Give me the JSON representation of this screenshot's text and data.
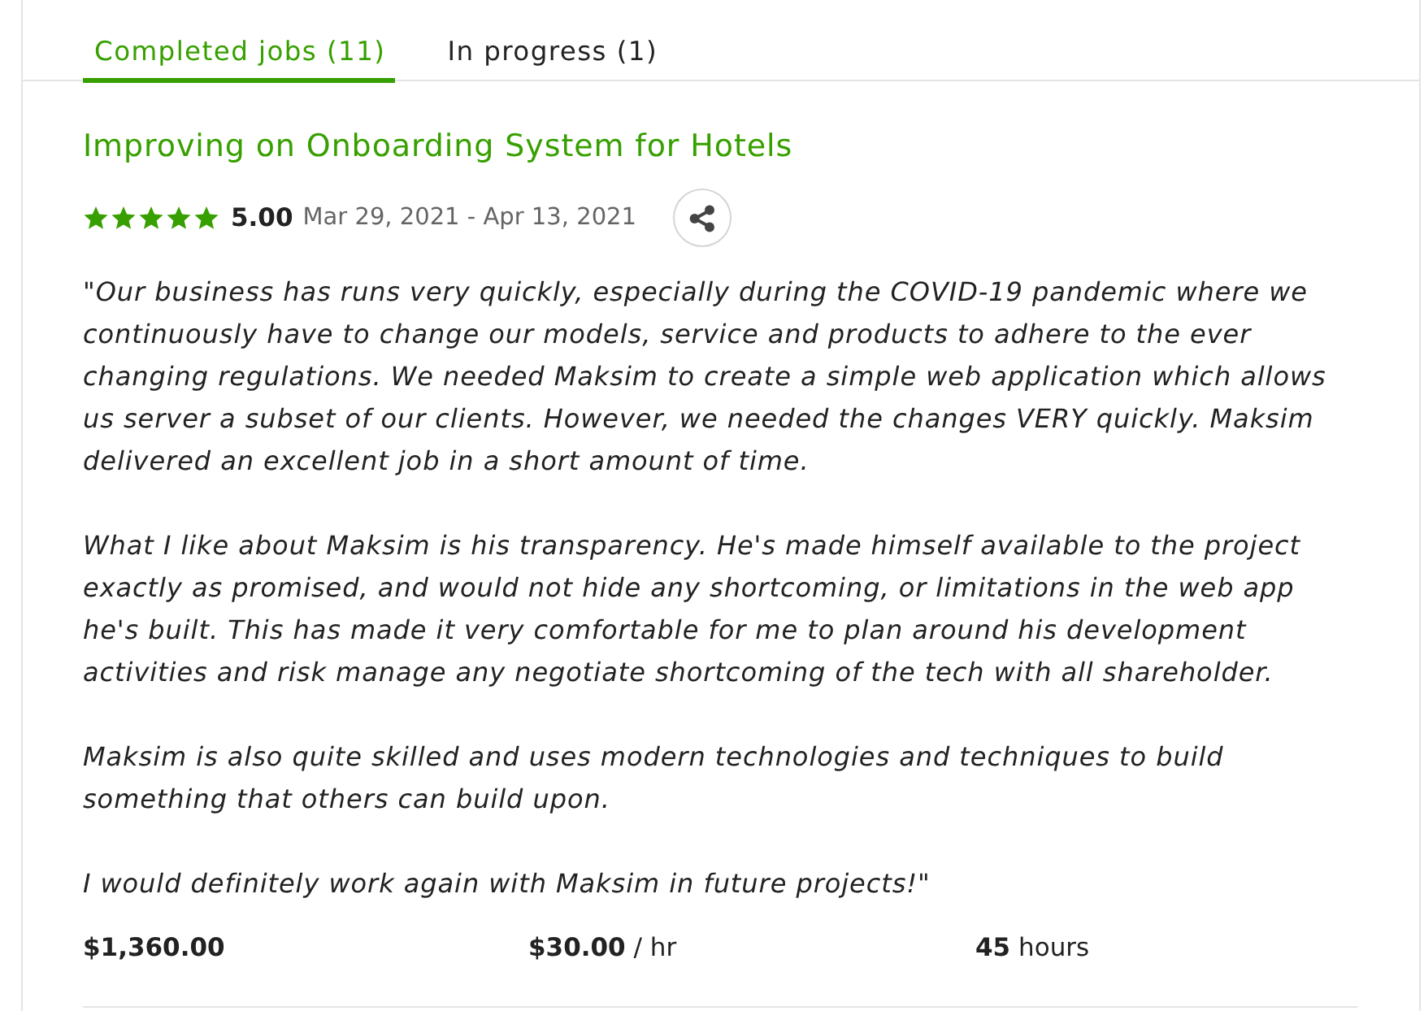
{
  "tabs": [
    {
      "label": "Completed jobs (11)",
      "selected": true
    },
    {
      "label": "In progress (1)",
      "selected": false
    }
  ],
  "job": {
    "title": "Improving on Onboarding System for Hotels",
    "stars": 5,
    "rating": "5.00",
    "dates": "Mar 29, 2021 - Apr 13, 2021",
    "review": [
      "\"Our business has runs very quickly, especially during the COVID-19 pandemic where we continuously have to change our models, service and products to adhere to the ever changing regulations. We needed Maksim to create a simple web application which allows us server a subset of our clients. However, we needed the changes VERY quickly. Maksim delivered an excellent job in a short amount of time.",
      "What I like about Maksim is his transparency. He's made himself available to the project exactly as promised, and would not hide any shortcoming, or limitations in the web app he's built. This has made it very comfortable for me to plan around his development activities and risk manage any negotiate shortcoming of the tech with all shareholder.",
      "Maksim is also quite skilled and uses modern technologies and techniques to build something that others can build upon.",
      "I would definitely work again with Maksim in future projects!\""
    ],
    "stats": [
      {
        "value": "$1,360.00"
      },
      {
        "value": "$30.00",
        "unit": "/ hr"
      },
      {
        "value": "45",
        "unit": "hours"
      }
    ]
  }
}
